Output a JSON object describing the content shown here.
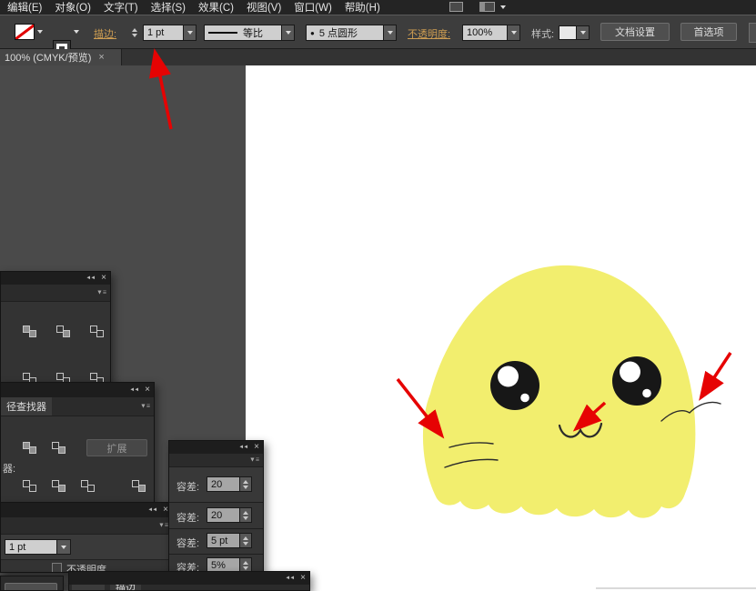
{
  "menu_bar": {
    "items": [
      "编辑(E)",
      "对象(O)",
      "文字(T)",
      "选择(S)",
      "效果(C)",
      "视图(V)",
      "窗口(W)",
      "帮助(H)"
    ]
  },
  "control_bar": {
    "stroke_label": "描边:",
    "stroke_value": "1 pt",
    "profile_value": "等比",
    "brush_dot": "●",
    "brush_value": "5 点圆形",
    "opacity_label": "不透明度:",
    "opacity_value": "100%",
    "style_label": "样式:",
    "doc_setup_button": "文档设置",
    "preferences_button": "首选项"
  },
  "tab_bar": {
    "document_tab": "100% (CMYK/预览)",
    "close_icon": "×"
  },
  "panels": {
    "icons": {
      "collapse": "◄◄",
      "close": "×",
      "flyout": "▼≡"
    },
    "pathfinder": {
      "tab": "径查找器",
      "expand_button": "扩展",
      "section_label": "器:"
    },
    "stroke_mini": {
      "weight_value": "1 pt",
      "opacity_label": "不透明度"
    },
    "tolerance_rows": [
      {
        "label": "容差:",
        "value": "20"
      },
      {
        "label": "容差:",
        "value": "20"
      },
      {
        "label": "容差:",
        "value": "5 pt"
      },
      {
        "label": "容差:",
        "value": "5%"
      }
    ],
    "bottom_panel": {
      "tab": "描边"
    }
  },
  "canvas": {
    "character": {
      "body_color": "#f2ee6e",
      "eye_color": "#171717",
      "line_color": "#2b2b2b",
      "highlight_color": "#ffffff"
    },
    "annotation_color": "#e60303"
  },
  "colors": {
    "menu_bar_bg": "#242424",
    "control_bar_bg": "#3d3d3d",
    "pasteboard_bg": "#4a4a4a",
    "artboard_bg": "#ffffff",
    "panel_bg": "#333333",
    "panel_header_bg": "#1d1d1d",
    "link_accent": "#cf9e52"
  }
}
